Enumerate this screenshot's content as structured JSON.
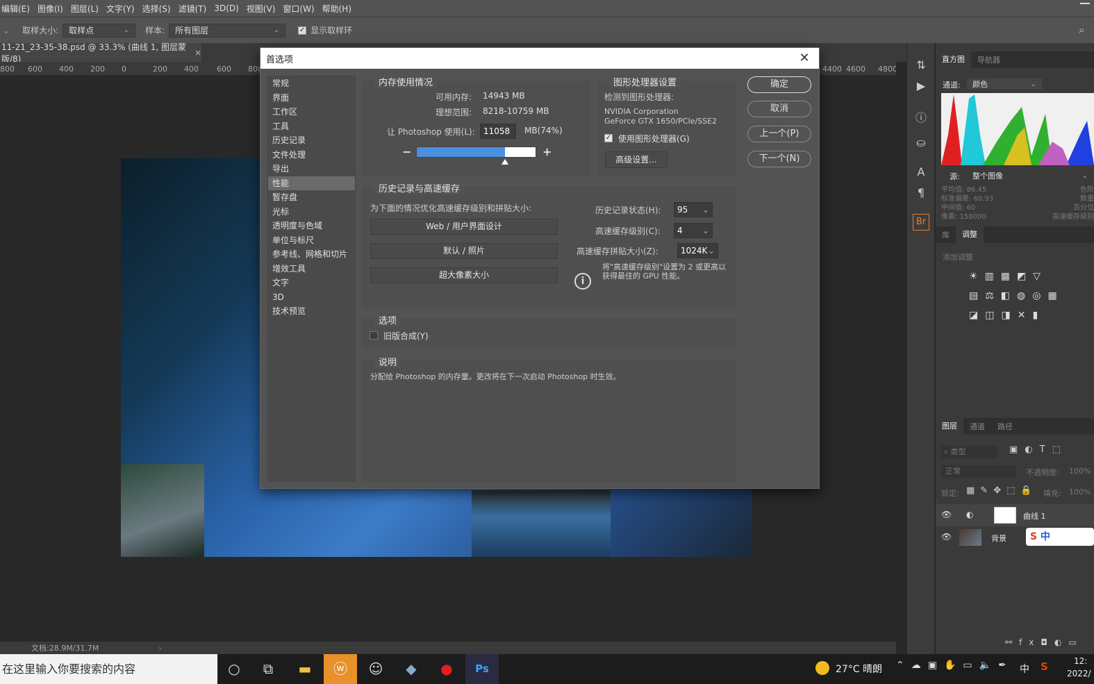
{
  "menubar": {
    "items": [
      "编辑(E)",
      "图像(I)",
      "图层(L)",
      "文字(Y)",
      "选择(S)",
      "滤镜(T)",
      "3D(D)",
      "视图(V)",
      "窗口(W)",
      "帮助(H)"
    ]
  },
  "options": {
    "sample_size_label": "取样大小:",
    "sample_size_value": "取样点",
    "sample_label": "样本:",
    "sample_value": "所有图层",
    "show_ring_label": "显示取样环"
  },
  "document": {
    "tab_title": "11-21_23-35-38.psd @ 33.3% (曲线 1, 图层蒙版/8)",
    "close": "×",
    "ruler_ticks": [
      "800",
      "600",
      "400",
      "200",
      "0",
      "200",
      "400",
      "600",
      "800"
    ],
    "ruler_ticks_right": [
      "4400",
      "4600",
      "4800"
    ],
    "status": "文档:28.9M/31.7M"
  },
  "dialog": {
    "title": "首选项",
    "close": "✕",
    "nav": [
      "常规",
      "界面",
      "工作区",
      "工具",
      "历史记录",
      "文件处理",
      "导出",
      "性能",
      "暂存盘",
      "光标",
      "透明度与色域",
      "单位与标尺",
      "参考线、网格和切片",
      "增效工具",
      "文字",
      "3D",
      "技术预览"
    ],
    "memory": {
      "title": "内存使用情况",
      "avail_label": "可用内存:",
      "avail_value": "14943 MB",
      "ideal_label": "理想范围:",
      "ideal_value": "8218-10759 MB",
      "use_label": "让 Photoshop 使用(L):",
      "use_value": "11058",
      "use_unit": "MB(74%)",
      "slider_fraction": 0.74,
      "minus": "−",
      "plus": "+"
    },
    "gpu": {
      "title": "图形处理器设置",
      "detected_label": "检测到图形处理器:",
      "vendor": "NVIDIA Corporation",
      "model": "GeForce GTX 1650/PCIe/SSE2",
      "use_label": "使用图形处理器(G)",
      "advanced": "高级设置..."
    },
    "history": {
      "title": "历史记录与高速缓存",
      "optimize_label": "为下面的情况优化高速缓存级别和拼贴大小:",
      "btn_web": "Web / 用户界面设计",
      "btn_default": "默认 / 照片",
      "btn_huge": "超大像素大小",
      "states_label": "历史记录状态(H):",
      "states_value": "95",
      "levels_label": "高速缓存级别(C):",
      "levels_value": "4",
      "tile_label": "高速缓存拼贴大小(Z):",
      "tile_value": "1024K",
      "tip": "将\"高速缓存级别\"设置为 2 或更高以获得最佳的 GPU 性能。",
      "info": "i"
    },
    "options": {
      "title": "选项",
      "legacy_label": "旧版合成(Y)"
    },
    "description": {
      "title": "说明",
      "text": "分配给 Photoshop 的内存量。更改将在下一次启动 Photoshop 时生效。"
    },
    "buttons": {
      "ok": "确定",
      "cancel": "取消",
      "prev": "上一个(P)",
      "next": "下一个(N)"
    }
  },
  "panels": {
    "top_tabs": [
      "直方图",
      "导航器"
    ],
    "channel_label": "通道:",
    "channel_value": "颜色",
    "source_label": "源:",
    "source_value": "整个图像",
    "stats": [
      {
        "l": "平均值:",
        "v": "86.45"
      },
      {
        "l": "标准偏差:",
        "v": "60.93"
      },
      {
        "l": "中间值:",
        "v": "60"
      },
      {
        "l": "像素:",
        "v": "158000"
      }
    ],
    "stats_right": [
      "色阶",
      "数量",
      "百分位",
      "高速缓存级别"
    ],
    "mid_tabs": [
      "库",
      "调整"
    ],
    "add_adjust": "添加调整",
    "layer_tabs": [
      "图层",
      "通道",
      "路径"
    ],
    "filter_placeholder": "类型",
    "blend_mode": "正常",
    "opacity_label": "不透明度:",
    "opacity_value": "100%",
    "lock_label": "锁定:",
    "fill_label": "填充:",
    "fill_value": "100%",
    "layers": [
      "曲线 1",
      "背景"
    ]
  },
  "taskbar": {
    "search_placeholder": "在这里输入你要搜索的内容",
    "weather": "27°C 晴朗",
    "ime": "中",
    "time": "12:",
    "date": "2022/"
  }
}
